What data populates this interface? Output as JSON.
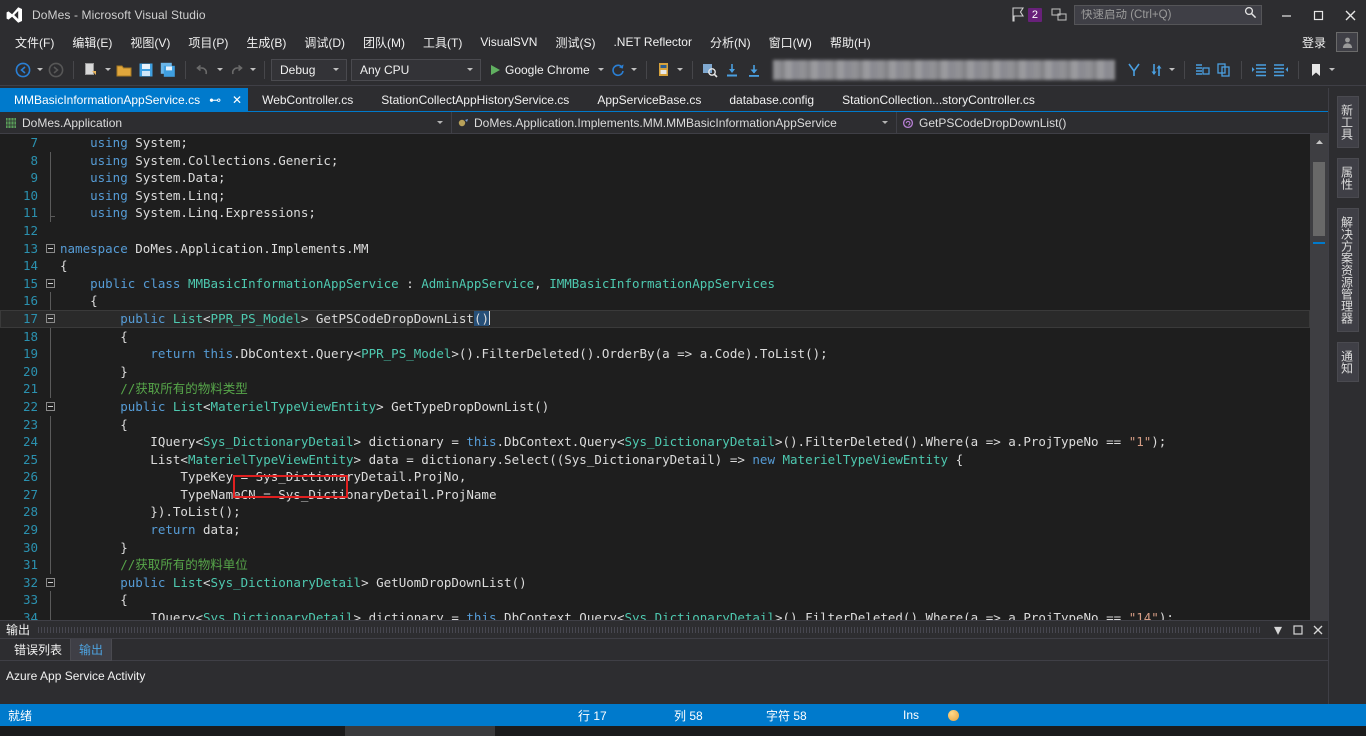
{
  "window": {
    "title": "DoMes - Microsoft Visual Studio",
    "logo_icon": "visual-studio-logo",
    "minimize_icon": "minimize-icon",
    "maximize_icon": "maximize-icon",
    "close_icon": "close-icon",
    "notification_count": "2",
    "flag_icon": "flag-icon",
    "feedback_icon": "feedback-icon",
    "quick_launch_placeholder": "快速启动 (Ctrl+Q)",
    "quick_launch_value": "",
    "search_icon": "search-icon"
  },
  "menubar": {
    "items": [
      {
        "label": "文件(F)"
      },
      {
        "label": "编辑(E)"
      },
      {
        "label": "视图(V)"
      },
      {
        "label": "项目(P)"
      },
      {
        "label": "生成(B)"
      },
      {
        "label": "调试(D)"
      },
      {
        "label": "团队(M)"
      },
      {
        "label": "工具(T)"
      },
      {
        "label": "VisualSVN"
      },
      {
        "label": "测试(S)"
      },
      {
        "label": ".NET Reflector"
      },
      {
        "label": "分析(N)"
      },
      {
        "label": "窗口(W)"
      },
      {
        "label": "帮助(H)"
      }
    ],
    "signin_label": "登录",
    "account_icon": "account-icon"
  },
  "toolbar": {
    "nav_back_icon": "navigate-back-icon",
    "nav_forward_icon": "navigate-forward-icon",
    "new_project_icon": "new-project-icon",
    "open_file_icon": "open-file-icon",
    "save_icon": "save-icon",
    "save_all_icon": "save-all-icon",
    "undo_icon": "undo-icon",
    "redo_icon": "redo-icon",
    "config_value": "Debug",
    "platform_value": "Any CPU",
    "start_label": "Google Chrome",
    "start_icon": "play-icon",
    "refresh_icon": "refresh-icon",
    "attach_icon": "attach-process-icon",
    "step_icon": "step-icon",
    "find_icon": "find-icon",
    "breakpoint_icon": "breakpoint-icon",
    "download_icon": "download-icon",
    "redacted_field": "",
    "branch_icon": "branch-icon",
    "sync_icon": "sync-icon",
    "comment_icon": "comment-icon",
    "uncomment_icon": "uncomment-icon",
    "indent_icon": "indent-icon",
    "outdent_icon": "outdent-icon",
    "bookmark_icon": "bookmark-icon"
  },
  "tabs": {
    "items": [
      {
        "label": "MMBasicInformationAppService.cs",
        "active": true
      },
      {
        "label": "WebController.cs",
        "active": false
      },
      {
        "label": "StationCollectAppHistoryService.cs",
        "active": false
      },
      {
        "label": "AppServiceBase.cs",
        "active": false
      },
      {
        "label": "database.config",
        "active": false
      },
      {
        "label": "StationCollection...storyController.cs",
        "active": false
      }
    ],
    "pin_icon": "pin-icon",
    "close_icon": "close-tab-icon",
    "overflow_icon": "tab-overflow-icon"
  },
  "navbar": {
    "project": "DoMes.Application",
    "project_icon": "project-icon",
    "type": "DoMes.Application.Implements.MM.MMBasicInformationAppService",
    "type_icon": "class-icon",
    "member": "GetPSCodeDropDownList()",
    "member_icon": "method-icon",
    "dropdown_icon": "chevron-down-icon"
  },
  "editor": {
    "first_line_number": 7,
    "current_line": 17,
    "lines": [
      {
        "n": 7,
        "glyph": "",
        "tokens": [
          {
            "t": "    ",
            "c": "p"
          },
          {
            "t": "using ",
            "c": "k"
          },
          {
            "t": "System;",
            "c": "p"
          }
        ]
      },
      {
        "n": 8,
        "glyph": "",
        "tokens": [
          {
            "t": "    ",
            "c": "p"
          },
          {
            "t": "using ",
            "c": "k"
          },
          {
            "t": "System.Collections.Generic;",
            "c": "p"
          }
        ]
      },
      {
        "n": 9,
        "glyph": "",
        "tokens": [
          {
            "t": "    ",
            "c": "p"
          },
          {
            "t": "using ",
            "c": "k"
          },
          {
            "t": "System.Data;",
            "c": "p"
          }
        ]
      },
      {
        "n": 10,
        "glyph": "",
        "tokens": [
          {
            "t": "    ",
            "c": "p"
          },
          {
            "t": "using ",
            "c": "k"
          },
          {
            "t": "System.Linq;",
            "c": "p"
          }
        ]
      },
      {
        "n": 11,
        "glyph": "",
        "tokens": [
          {
            "t": "    ",
            "c": "p"
          },
          {
            "t": "using ",
            "c": "k"
          },
          {
            "t": "System.Linq.Expressions;",
            "c": "p"
          }
        ]
      },
      {
        "n": 12,
        "glyph": "",
        "tokens": [
          {
            "t": "",
            "c": "p"
          }
        ]
      },
      {
        "n": 13,
        "glyph": "minus",
        "tokens": [
          {
            "t": "namespace ",
            "c": "k"
          },
          {
            "t": "DoMes.Application.Implements.MM",
            "c": "p"
          }
        ]
      },
      {
        "n": 14,
        "glyph": "",
        "tokens": [
          {
            "t": "{",
            "c": "p"
          }
        ]
      },
      {
        "n": 15,
        "glyph": "minus",
        "tokens": [
          {
            "t": "    ",
            "c": "p"
          },
          {
            "t": "public ",
            "c": "k"
          },
          {
            "t": "class ",
            "c": "k"
          },
          {
            "t": "MMBasicInformationAppService",
            "c": "t"
          },
          {
            "t": " : ",
            "c": "p"
          },
          {
            "t": "AdminAppService",
            "c": "t"
          },
          {
            "t": ", ",
            "c": "p"
          },
          {
            "t": "IMMBasicInformationAppServices",
            "c": "t"
          }
        ]
      },
      {
        "n": 16,
        "glyph": "",
        "tokens": [
          {
            "t": "    {",
            "c": "p"
          }
        ]
      },
      {
        "n": 17,
        "glyph": "minus",
        "current": true,
        "tokens": [
          {
            "t": "        ",
            "c": "p"
          },
          {
            "t": "public ",
            "c": "k"
          },
          {
            "t": "List",
            "c": "t"
          },
          {
            "t": "<",
            "c": "p"
          },
          {
            "t": "PPR_PS_Model",
            "c": "t"
          },
          {
            "t": "> GetPSCodeDropDownList",
            "c": "p"
          },
          {
            "t": "()",
            "c": "sel"
          }
        ]
      },
      {
        "n": 18,
        "glyph": "",
        "tokens": [
          {
            "t": "        {",
            "c": "p"
          }
        ]
      },
      {
        "n": 19,
        "glyph": "",
        "tokens": [
          {
            "t": "            ",
            "c": "p"
          },
          {
            "t": "return ",
            "c": "k"
          },
          {
            "t": "this",
            "c": "k"
          },
          {
            "t": ".DbContext.Query",
            "c": "p"
          },
          {
            "t": "<",
            "c": "p"
          },
          {
            "t": "PPR_PS_Model",
            "c": "t"
          },
          {
            "t": ">().FilterDeleted().OrderBy(a => a.Code).ToList();",
            "c": "p"
          }
        ]
      },
      {
        "n": 20,
        "glyph": "",
        "tokens": [
          {
            "t": "        }",
            "c": "p"
          }
        ]
      },
      {
        "n": 21,
        "glyph": "",
        "tokens": [
          {
            "t": "        ",
            "c": "p"
          },
          {
            "t": "//获取所有的物料类型",
            "c": "cm"
          }
        ]
      },
      {
        "n": 22,
        "glyph": "minus",
        "tokens": [
          {
            "t": "        ",
            "c": "p"
          },
          {
            "t": "public ",
            "c": "k"
          },
          {
            "t": "List",
            "c": "t"
          },
          {
            "t": "<",
            "c": "p"
          },
          {
            "t": "MaterielTypeViewEntity",
            "c": "t"
          },
          {
            "t": "> GetTypeDropDownList()",
            "c": "p"
          }
        ]
      },
      {
        "n": 23,
        "glyph": "",
        "tokens": [
          {
            "t": "        {",
            "c": "p"
          }
        ]
      },
      {
        "n": 24,
        "glyph": "",
        "tokens": [
          {
            "t": "            IQuery",
            "c": "p"
          },
          {
            "t": "<",
            "c": "p"
          },
          {
            "t": "Sys_DictionaryDetail",
            "c": "t"
          },
          {
            "t": "> dictionary = ",
            "c": "p"
          },
          {
            "t": "this",
            "c": "k"
          },
          {
            "t": ".DbContext.Query",
            "c": "p"
          },
          {
            "t": "<",
            "c": "p"
          },
          {
            "t": "Sys_DictionaryDetail",
            "c": "t"
          },
          {
            "t": ">().FilterDeleted().Where(a => a.ProjTypeNo == ",
            "c": "p"
          },
          {
            "t": "\"1\"",
            "c": "s"
          },
          {
            "t": ");",
            "c": "p"
          }
        ]
      },
      {
        "n": 25,
        "glyph": "",
        "tokens": [
          {
            "t": "            List",
            "c": "p"
          },
          {
            "t": "<",
            "c": "p"
          },
          {
            "t": "MaterielTypeViewEntity",
            "c": "t"
          },
          {
            "t": "> data = dictionary.Select((Sys_DictionaryDetail) => ",
            "c": "p"
          },
          {
            "t": "new ",
            "c": "k"
          },
          {
            "t": "MaterielTypeViewEntity",
            "c": "t"
          },
          {
            "t": " {",
            "c": "p"
          }
        ]
      },
      {
        "n": 26,
        "glyph": "",
        "tokens": [
          {
            "t": "                TypeKey = Sys_DictionaryDetail.ProjNo,",
            "c": "p"
          }
        ]
      },
      {
        "n": 27,
        "glyph": "",
        "tokens": [
          {
            "t": "                TypeNameCN = Sys_DictionaryDetail.ProjName",
            "c": "p"
          }
        ]
      },
      {
        "n": 28,
        "glyph": "",
        "tokens": [
          {
            "t": "            }).ToList();",
            "c": "p"
          }
        ]
      },
      {
        "n": 29,
        "glyph": "",
        "tokens": [
          {
            "t": "            ",
            "c": "p"
          },
          {
            "t": "return ",
            "c": "k"
          },
          {
            "t": "data;",
            "c": "p"
          }
        ]
      },
      {
        "n": 30,
        "glyph": "",
        "tokens": [
          {
            "t": "        }",
            "c": "p"
          }
        ]
      },
      {
        "n": 31,
        "glyph": "",
        "tokens": [
          {
            "t": "        ",
            "c": "p"
          },
          {
            "t": "//获取所有的物料单位",
            "c": "cm"
          }
        ]
      },
      {
        "n": 32,
        "glyph": "minus",
        "tokens": [
          {
            "t": "        ",
            "c": "p"
          },
          {
            "t": "public ",
            "c": "k"
          },
          {
            "t": "List",
            "c": "t"
          },
          {
            "t": "<",
            "c": "p"
          },
          {
            "t": "Sys_DictionaryDetail",
            "c": "t"
          },
          {
            "t": "> GetUomDropDownList()",
            "c": "p"
          }
        ]
      },
      {
        "n": 33,
        "glyph": "",
        "tokens": [
          {
            "t": "        {",
            "c": "p"
          }
        ]
      },
      {
        "n": 34,
        "glyph": "",
        "tokens": [
          {
            "t": "            IQuery",
            "c": "p"
          },
          {
            "t": "<",
            "c": "p"
          },
          {
            "t": "Sys_DictionaryDetail",
            "c": "t"
          },
          {
            "t": "> dictionary = ",
            "c": "p"
          },
          {
            "t": "this",
            "c": "k"
          },
          {
            "t": ".DbContext.Query",
            "c": "p"
          },
          {
            "t": "<",
            "c": "p"
          },
          {
            "t": "Sys_DictionaryDetail",
            "c": "t"
          },
          {
            "t": ">().FilterDeleted().Where(a => a.ProjTypeNo == ",
            "c": "p"
          },
          {
            "t": "\"14\"",
            "c": "s"
          },
          {
            "t": ");",
            "c": "p"
          }
        ]
      }
    ],
    "annotation": {
      "name": "red-highlight-box",
      "target": "this.DbContext."
    },
    "colors": {
      "background": "#1e1e1e",
      "keyword": "#569cd6",
      "type": "#4ec9b0",
      "comment": "#57a64a",
      "string": "#d69d85",
      "text": "#dcdcdc",
      "line_number": "#2b91af",
      "annotation_box": "#e02020",
      "accent": "#007acc"
    }
  },
  "output_panel": {
    "title": "输出",
    "dropdown_icon": "chevron-down-icon",
    "maximize_icon": "maximize-panel-icon",
    "close_icon": "close-panel-icon",
    "tabs": [
      {
        "label": "错误列表",
        "active": false
      },
      {
        "label": "输出",
        "active": true
      }
    ],
    "body_text": "Azure App Service Activity"
  },
  "right_rail": {
    "tabs": [
      {
        "label": "新工具"
      },
      {
        "label": "属性"
      },
      {
        "label": "解决方案资源管理器"
      },
      {
        "label": "通知"
      }
    ]
  },
  "statusbar": {
    "ready": "就绪",
    "line_label": "行 17",
    "col_label": "列 58",
    "char_label": "字符 58",
    "insert_mode": "Ins",
    "indicator_icon": "status-indicator-icon",
    "background": "#007acc"
  }
}
